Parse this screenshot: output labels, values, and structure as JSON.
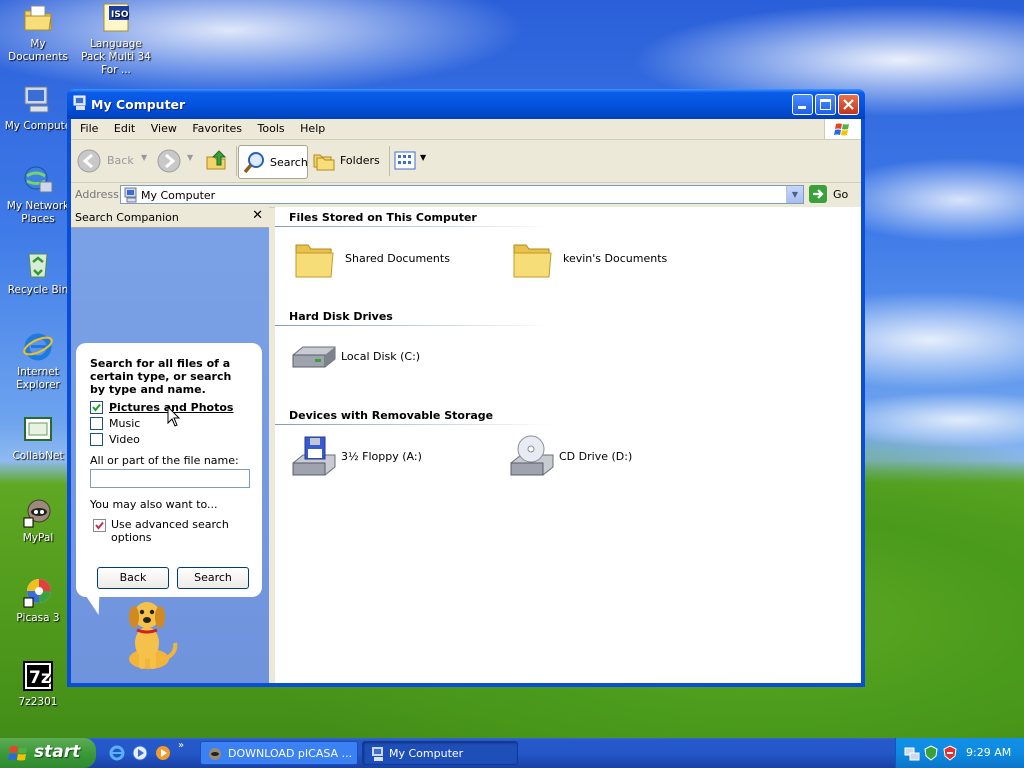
{
  "desktop": {
    "icons": [
      {
        "label": "My Documents",
        "icon": "my-documents-icon"
      },
      {
        "label": "Language Pack Multi 34 For ...",
        "icon": "iso-file-icon"
      },
      {
        "label": "My Compute",
        "icon": "my-computer-icon"
      },
      {
        "label": "My Network Places",
        "icon": "network-places-icon"
      },
      {
        "label": "Recycle Bin",
        "icon": "recycle-bin-icon"
      },
      {
        "label": "Internet Explorer",
        "icon": "internet-explorer-icon"
      },
      {
        "label": "CollabNet",
        "icon": "collabnet-icon"
      },
      {
        "label": "MyPal",
        "icon": "mypal-icon"
      },
      {
        "label": "Picasa 3",
        "icon": "picasa-icon"
      },
      {
        "label": "7z2301",
        "icon": "7zip-icon"
      }
    ]
  },
  "window": {
    "title": "My Computer",
    "menu": [
      "File",
      "Edit",
      "View",
      "Favorites",
      "Tools",
      "Help"
    ],
    "toolbar": {
      "back": "Back",
      "search": "Search",
      "folders": "Folders"
    },
    "address": {
      "label": "Address",
      "value": "My Computer",
      "go": "Go"
    },
    "search_companion": {
      "title": "Search Companion",
      "prompt": "Search for all files of a certain type, or search by type and name.",
      "options": [
        {
          "label": "Pictures and Photos",
          "checked": true
        },
        {
          "label": "Music",
          "checked": false
        },
        {
          "label": "Video",
          "checked": false
        }
      ],
      "filename_label": "All or part of the file name:",
      "filename_value": "",
      "also_label": "You may also want to...",
      "advanced_label": "Use advanced search options",
      "advanced_checked": true,
      "back_button": "Back",
      "search_button": "Search"
    },
    "groups": {
      "files_stored": "Files Stored on This Computer",
      "hard_disks": "Hard Disk Drives",
      "removable": "Devices with Removable Storage"
    },
    "items": {
      "shared_docs": "Shared Documents",
      "kevins_docs": "kevin's Documents",
      "local_disk": "Local Disk (C:)",
      "floppy": "3½ Floppy (A:)",
      "cd_drive": "CD Drive (D:)"
    }
  },
  "taskbar": {
    "start": "start",
    "tasks": [
      "DOWNLOAD pICASA ...",
      "My Computer"
    ],
    "clock": "9:29 AM"
  }
}
